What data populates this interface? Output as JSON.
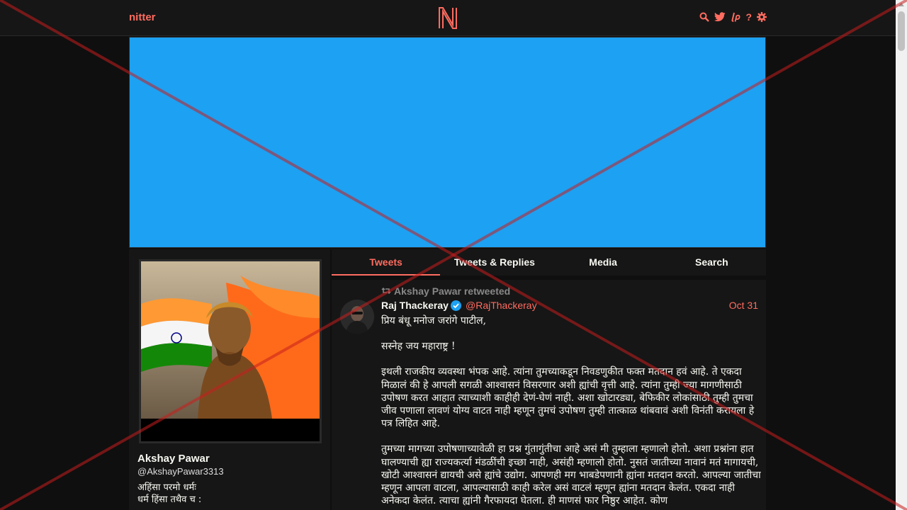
{
  "nav": {
    "brand": "nitter",
    "icons": [
      "search-icon",
      "twitter-bird-icon",
      "liberapay-icon",
      "help-icon",
      "gear-icon"
    ],
    "help_glyph": "?"
  },
  "colors": {
    "accent": "#ff6c60",
    "background": "#0f0f0f",
    "panel": "#161616",
    "banner": "#1da1f2",
    "muted": "#888889"
  },
  "profile": {
    "fullname": "Akshay Pawar",
    "username": "@AkshayPawar3313",
    "bio": "अहिंसा परमो धर्मः\nधर्म हिंसा तथैव च :"
  },
  "tabs": [
    {
      "label": "Tweets",
      "active": true
    },
    {
      "label": "Tweets & Replies",
      "active": false
    },
    {
      "label": "Media",
      "active": false
    },
    {
      "label": "Search",
      "active": false
    }
  ],
  "tweet": {
    "retweet_header": "Akshay Pawar retweeted",
    "fullname": "Raj Thackeray",
    "username": "@RajThackeray",
    "date": "Oct 31",
    "paragraphs": [
      "प्रिय बंधू मनोज जरांगे पाटील,",
      "सस्नेह जय महाराष्ट्र !",
      "इथली राजकीय व्यवस्था भंपक आहे. त्यांना तुमच्याकडून निवडणुकीत फक्त मतदान हवं आहे. ते एकदा मिळालं की हे आपली सगळी आश्वासनं विसरणार अशी ह्यांची वृत्ती आहे. त्यांना तुम्ही ज्या मागणीसाठी उपोषण करत आहात त्याच्याशी काहीही देणं-घेणं नाही. अशा खोटारड्या, बेफिकीर लोकांसाठी तुम्ही तुमचा जीव पणाला लावणं योग्य वाटत नाही म्हणून तुमचं उपोषण तुम्ही तात्काळ थांबवावं अशी विनंती करायला हे पत्र लिहित आहे.",
      "तुमच्या मागच्या उपोषणाच्यावेळी हा प्रश्न गुंतागुंतीचा आहे असं मी तुम्हाला म्हणालो होतो. अशा प्रश्नांना हात घालण्याची ह्या राज्यकर्त्या मंडळींची इच्छा नाही, असंही म्हणालो होतो. नुसतं जातीच्या नावानं मतं मागायची, खोटी आश्वासनं द्यायची असे ह्यांचे उद्योग. आपणही मग भाबडेपणानी ह्यांना मतदान करतो. आपल्या जातीचा म्हणून आपला वाटला, आपल्यासाठी काही करेल असं वाटलं म्हणून ह्यांना मतदान केलंत. एकदा नाही अनेकदा केलंत. त्याचा ह्यांनी गैरफायदा घेतला. ही माणसं फार निष्ठुर आहेत. कोण"
    ]
  }
}
